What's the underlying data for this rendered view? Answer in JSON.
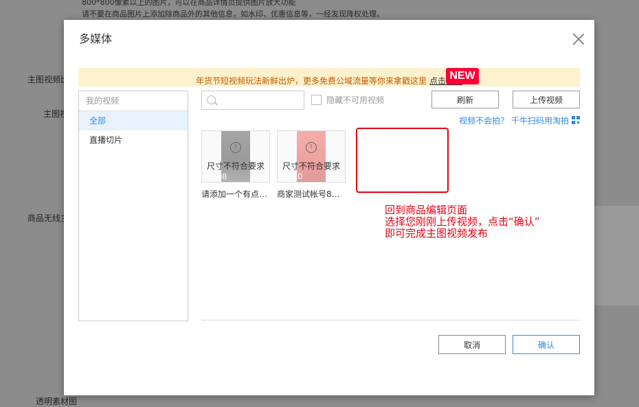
{
  "background": {
    "line1": "800*800像素以上的图片，可以在商品详情页提供图片放大功能",
    "line2": "请不要在商品图片上添加除商品外的其他信息，如水印、优惠信息等，一经发现降权处理。",
    "label_main_video": "主图视频比",
    "label_main": "主图视",
    "label_wireless": "商品无线主",
    "label_transparent": "透明素材图"
  },
  "dialog": {
    "title": "多媒体",
    "notice_text": "年货节短视频玩法新鲜出炉，更多免费公域流量等你来拿戳这里",
    "notice_link": "点击查看",
    "new_badge": "NEW"
  },
  "sidebar": {
    "header": "我的视频",
    "items": [
      {
        "label": "全部",
        "active": true
      },
      {
        "label": "直播切片",
        "active": false
      }
    ]
  },
  "toolbar": {
    "search_placeholder": "",
    "hide_unavailable_label": "隐藏不可用视频",
    "refresh_label": "刷新",
    "upload_label": "上传视频",
    "hint_link": "视频不会拍？ 千牛扫码用淘拍"
  },
  "videos": [
    {
      "status": "尺寸不符合要求",
      "duration": "00:38",
      "title": "请添加一个有点…",
      "thumb_color": "#2b2b2b"
    },
    {
      "status": "尺寸不符合要求",
      "duration": "00:10",
      "title": "商家测试帐号8…",
      "thumb_color": "#d9322e"
    }
  ],
  "annotation": {
    "line1": "回到商品编辑页面",
    "line2": "选择您刚刚上传视频，点击“确认”",
    "line3": "即可完成主图视频发布"
  },
  "footer": {
    "cancel_label": "取消",
    "confirm_label": "确认"
  },
  "colors": {
    "accent": "#3089dc",
    "warning_bg": "#fdf1cd",
    "annotation": "#e60012"
  }
}
